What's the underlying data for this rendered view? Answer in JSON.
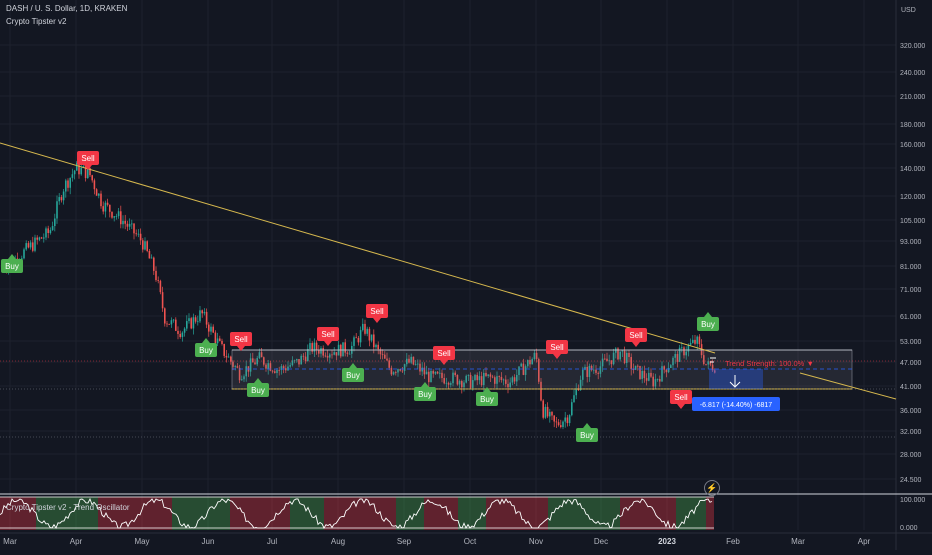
{
  "header": {
    "symbol_line": "DASH / U. S. Dollar, 1D, KRAKEN",
    "indicator_line": "Crypto Tipster v2",
    "oscillator_label": "Crypto Tipster v2 - Trend Oscillator"
  },
  "price_axis": {
    "currency": "USD",
    "ticks": [
      "320.000",
      "240.000",
      "210.000",
      "180.000",
      "160.000",
      "140.000",
      "120.000",
      "105.000",
      "93.000",
      "81.000",
      "71.000",
      "61.000",
      "53.000",
      "47.000",
      "41.000",
      "36.000",
      "32.000",
      "28.000",
      "24.500"
    ]
  },
  "oscillator_axis": {
    "ticks": [
      "100.000",
      "0.000"
    ]
  },
  "time_axis": {
    "ticks": [
      "Mar",
      "Apr",
      "May",
      "Jun",
      "Jul",
      "Aug",
      "Sep",
      "Oct",
      "Nov",
      "Dec",
      "2023",
      "Feb",
      "Mar",
      "Apr"
    ]
  },
  "signals": [
    {
      "label": "Buy",
      "type": "buy"
    },
    {
      "label": "Sell",
      "type": "sell"
    },
    {
      "label": "Buy",
      "type": "buy"
    },
    {
      "label": "Sell",
      "type": "sell"
    },
    {
      "label": "Buy",
      "type": "buy"
    },
    {
      "label": "Sell",
      "type": "sell"
    },
    {
      "label": "Buy",
      "type": "buy"
    },
    {
      "label": "Sell",
      "type": "sell"
    },
    {
      "label": "Sell",
      "type": "sell"
    },
    {
      "label": "Buy",
      "type": "buy"
    },
    {
      "label": "Buy",
      "type": "buy"
    },
    {
      "label": "Sell",
      "type": "sell"
    },
    {
      "label": "Buy",
      "type": "buy"
    },
    {
      "label": "Sell",
      "type": "sell"
    },
    {
      "label": "Sell",
      "type": "sell"
    },
    {
      "label": "Buy",
      "type": "buy"
    }
  ],
  "trend_strength": "Trend Strength: 100.0% ▼",
  "measure_label": "-6.817 (-14.40%) -6817",
  "colors": {
    "background": "#131722",
    "up": "#26a69a",
    "down": "#ef5350",
    "buy": "#4caf50",
    "sell": "#f23645",
    "trendline": "#d6b84e",
    "range_box": "#787b86",
    "measure": "#2962ff",
    "oscillator": "#ffffff"
  },
  "chart_data": [
    {
      "type": "candlestick",
      "title": "DASH / U. S. Dollar, 1D, KRAKEN",
      "y_scale": "log",
      "ylim": [
        24,
        400
      ],
      "x_ticks": [
        "Mar",
        "Apr",
        "May",
        "Jun",
        "Jul",
        "Aug",
        "Sep",
        "Oct",
        "Nov",
        "Dec",
        "2023",
        "Feb",
        "Mar",
        "Apr"
      ],
      "series": [
        {
          "name": "close",
          "keypoints": [
            {
              "month": 0.0,
              "price": 82
            },
            {
              "month": 0.3,
              "price": 90
            },
            {
              "month": 0.6,
              "price": 98
            },
            {
              "month": 0.8,
              "price": 125
            },
            {
              "month": 1.0,
              "price": 140
            },
            {
              "month": 1.2,
              "price": 136
            },
            {
              "month": 1.4,
              "price": 115
            },
            {
              "month": 1.7,
              "price": 105
            },
            {
              "month": 2.0,
              "price": 93
            },
            {
              "month": 2.2,
              "price": 78
            },
            {
              "month": 2.35,
              "price": 60
            },
            {
              "month": 2.6,
              "price": 56
            },
            {
              "month": 2.9,
              "price": 62
            },
            {
              "month": 3.2,
              "price": 51
            },
            {
              "month": 3.5,
              "price": 44
            },
            {
              "month": 3.8,
              "price": 48
            },
            {
              "month": 4.1,
              "price": 45
            },
            {
              "month": 4.4,
              "price": 47
            },
            {
              "month": 4.6,
              "price": 51
            },
            {
              "month": 4.9,
              "price": 50
            },
            {
              "month": 5.2,
              "price": 51
            },
            {
              "month": 5.4,
              "price": 57
            },
            {
              "month": 5.6,
              "price": 50
            },
            {
              "month": 5.8,
              "price": 45
            },
            {
              "month": 6.1,
              "price": 47
            },
            {
              "month": 6.4,
              "price": 43
            },
            {
              "month": 6.7,
              "price": 43
            },
            {
              "month": 7.0,
              "price": 42
            },
            {
              "month": 7.3,
              "price": 43
            },
            {
              "month": 7.6,
              "price": 42
            },
            {
              "month": 7.9,
              "price": 47
            },
            {
              "month": 8.0,
              "price": 49
            },
            {
              "month": 8.1,
              "price": 36
            },
            {
              "month": 8.3,
              "price": 33
            },
            {
              "month": 8.5,
              "price": 35
            },
            {
              "month": 8.7,
              "price": 44
            },
            {
              "month": 9.0,
              "price": 46
            },
            {
              "month": 9.3,
              "price": 50
            },
            {
              "month": 9.5,
              "price": 45
            },
            {
              "month": 9.8,
              "price": 42
            },
            {
              "month": 10.0,
              "price": 46
            },
            {
              "month": 10.3,
              "price": 51
            },
            {
              "month": 10.45,
              "price": 53
            },
            {
              "month": 10.6,
              "price": 46
            }
          ]
        }
      ]
    },
    {
      "type": "line",
      "title": "Crypto Tipster v2 - Trend Oscillator",
      "ylim": [
        0,
        100
      ]
    }
  ]
}
